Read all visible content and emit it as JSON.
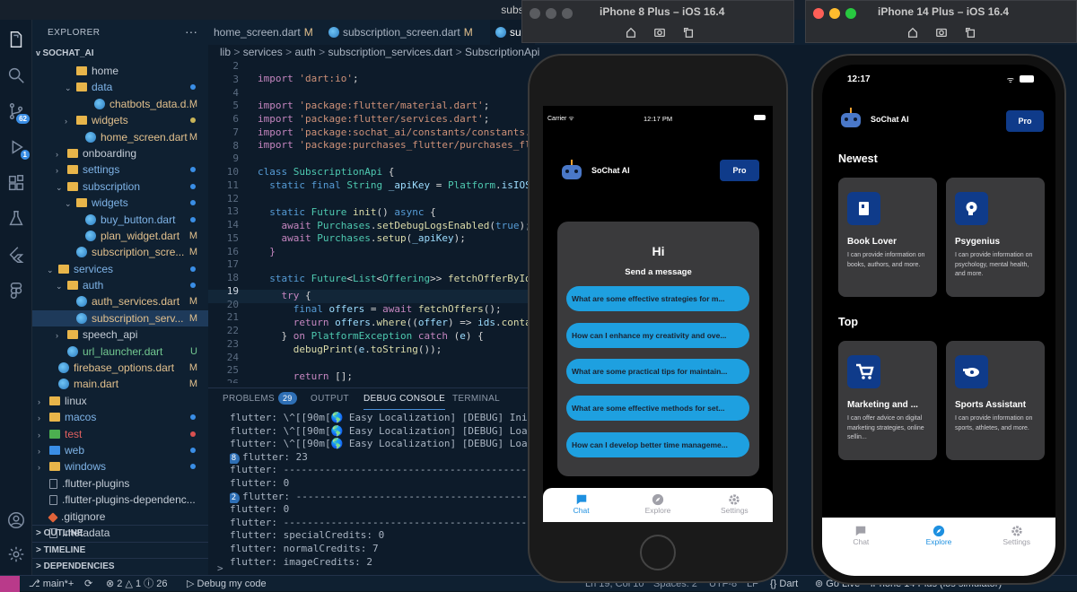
{
  "vscode": {
    "window_title": "subscription_se",
    "explorer_title": "EXPLORER",
    "explorer_more": "···",
    "root": "SOCHAT_AI",
    "scm_badge": "62",
    "debug_badge": "1",
    "tree": [
      {
        "label": "home",
        "type": "folder",
        "depth": 3,
        "chev": "",
        "status": ""
      },
      {
        "label": "data",
        "type": "folder",
        "depth": 3,
        "chev": "v",
        "status": "dot",
        "status_color": "#3a8ee6"
      },
      {
        "label": "chatbots_data.d...",
        "type": "dart",
        "depth": 5,
        "chev": "",
        "status": "M"
      },
      {
        "label": "widgets",
        "type": "folder",
        "depth": 3,
        "chev": ">",
        "status": "dot",
        "status_color": "#c9b458",
        "color": "#e2c08d"
      },
      {
        "label": "home_screen.dart",
        "type": "dart",
        "depth": 4,
        "chev": "",
        "status": "M"
      },
      {
        "label": "onboarding",
        "type": "folder",
        "depth": 2,
        "chev": ">",
        "status": ""
      },
      {
        "label": "settings",
        "type": "folder",
        "depth": 2,
        "chev": ">",
        "status": "dot",
        "status_color": "#3a8ee6"
      },
      {
        "label": "subscription",
        "type": "folder",
        "depth": 2,
        "chev": "v",
        "status": "dot",
        "status_color": "#3a8ee6"
      },
      {
        "label": "widgets",
        "type": "folder",
        "depth": 3,
        "chev": "v",
        "status": "dot",
        "status_color": "#3a8ee6"
      },
      {
        "label": "buy_button.dart",
        "type": "dart",
        "depth": 4,
        "chev": "",
        "status": "dot",
        "status_color": "#3a8ee6"
      },
      {
        "label": "plan_widget.dart",
        "type": "dart",
        "depth": 4,
        "chev": "",
        "status": "M"
      },
      {
        "label": "subscription_scre...",
        "type": "dart",
        "depth": 3,
        "chev": "",
        "status": "M"
      },
      {
        "label": "services",
        "type": "folder",
        "depth": 1,
        "chev": "v",
        "status": "dot",
        "status_color": "#3a8ee6"
      },
      {
        "label": "auth",
        "type": "folder",
        "depth": 2,
        "chev": "v",
        "status": "dot",
        "status_color": "#3a8ee6"
      },
      {
        "label": "auth_services.dart",
        "type": "dart",
        "depth": 3,
        "chev": "",
        "status": "M"
      },
      {
        "label": "subscription_serv...",
        "type": "dart",
        "depth": 3,
        "chev": "",
        "status": "M",
        "selected": true
      },
      {
        "label": "speech_api",
        "type": "folder",
        "depth": 2,
        "chev": ">",
        "status": ""
      },
      {
        "label": "url_launcher.dart",
        "type": "dart",
        "depth": 2,
        "chev": "",
        "status": "U"
      },
      {
        "label": "firebase_options.dart",
        "type": "dart",
        "depth": 1,
        "chev": "",
        "status": "M"
      },
      {
        "label": "main.dart",
        "type": "dart",
        "depth": 1,
        "chev": "",
        "status": "M"
      },
      {
        "label": "linux",
        "type": "folder",
        "depth": 0,
        "chev": ">",
        "status": ""
      },
      {
        "label": "macos",
        "type": "folder",
        "depth": 0,
        "chev": ">",
        "status": "dot",
        "status_color": "#3a8ee6"
      },
      {
        "label": "test",
        "type": "folder",
        "depth": 0,
        "chev": ">",
        "status": "dot",
        "status_color": "#d85050",
        "color": "#e06060",
        "icon_color": "#4caf50"
      },
      {
        "label": "web",
        "type": "folder",
        "depth": 0,
        "chev": ">",
        "status": "dot",
        "status_color": "#3a8ee6",
        "icon_color": "#3a8ee6"
      },
      {
        "label": "windows",
        "type": "folder",
        "depth": 0,
        "chev": ">",
        "status": "dot",
        "status_color": "#3a8ee6"
      },
      {
        "label": ".flutter-plugins",
        "type": "file",
        "depth": 0,
        "chev": "",
        "status": ""
      },
      {
        "label": ".flutter-plugins-dependenc...",
        "type": "file",
        "depth": 0,
        "chev": "",
        "status": ""
      },
      {
        "label": ".gitignore",
        "type": "git",
        "depth": 0,
        "chev": "",
        "status": ""
      },
      {
        "label": ".metadata",
        "type": "file",
        "depth": 0,
        "chev": "",
        "status": ""
      }
    ],
    "sections": [
      "OUTLINE",
      "TIMELINE",
      "DEPENDENCIES"
    ],
    "tabs": [
      {
        "label": "home_screen.dart",
        "mod": "M"
      },
      {
        "label": "subscription_screen.dart",
        "mod": "M"
      },
      {
        "label": "su",
        "mod": ""
      }
    ],
    "breadcrumb": [
      "lib",
      ">",
      "services",
      ">",
      "auth",
      ">",
      "subscription_services.dart",
      ">",
      "SubscriptionApi",
      ">",
      "fetchOffersByI"
    ],
    "line_numbers": [
      "2",
      "3",
      "4",
      "5",
      "6",
      "7",
      "8",
      "9",
      "10",
      "11",
      "12",
      "13",
      "14",
      "15",
      "16",
      "17",
      "18",
      "19",
      "20",
      "21",
      "22",
      "23",
      "24",
      "25",
      "26"
    ],
    "panel_tabs": [
      "PROBLEMS",
      "OUTPUT",
      "DEBUG CONSOLE",
      "TERMINAL"
    ],
    "problems_count": "29",
    "console": [
      {
        "count": "",
        "text": "flutter: \\^[[90m[🌎 Easy Localization] [DEBUG] Init prov"
      },
      {
        "count": "",
        "text": "flutter: \\^[[90m[🌎 Easy Localization] [DEBUG] Load Loca"
      },
      {
        "count": "",
        "text": "flutter: \\^[[90m[🌎 Easy Localization] [DEBUG] Load asse"
      },
      {
        "count": "8",
        "text": "flutter: 23"
      },
      {
        "count": "",
        "text": "flutter: ---------------------------------------------"
      },
      {
        "count": "",
        "text": "flutter: 0"
      },
      {
        "count": "2",
        "text": "flutter: --------------------------------------------"
      },
      {
        "count": "",
        "text": "flutter: 0"
      },
      {
        "count": "",
        "text": "flutter: ---------------------------------------------"
      },
      {
        "count": "",
        "text": "flutter: specialCredits: 0"
      },
      {
        "count": "",
        "text": "flutter: normalCredits: 7"
      },
      {
        "count": "",
        "text": "flutter: imageCredits: 2"
      }
    ],
    "prompt": ">",
    "status": {
      "branch": "main*+",
      "errors": "2",
      "warnings": "1",
      "infos": "26",
      "debug": "Debug my code",
      "position": "Ln 19, Col 10",
      "spaces": "Spaces: 2",
      "encoding": "UTF-8",
      "eol": "LF",
      "lang": "Dart",
      "golive": "Go Live",
      "device": "iPhone 14 Plus (ios simulator)"
    }
  },
  "sim1": {
    "title": "iPhone 8 Plus – iOS 16.4",
    "carrier": "Carrier",
    "time": "12:17 PM",
    "app_name": "SoChat AI",
    "pro": "Pro",
    "hi": "Hi",
    "send_message": "Send a message",
    "suggestions": [
      "What are some effective strategies for m...",
      "How can I enhance my creativity and ove...",
      "What are some practical tips for maintain...",
      "What are some effective methods for set...",
      "How can I develop better time manageme..."
    ],
    "tabs": [
      "Chat",
      "Explore",
      "Settings"
    ],
    "active_tab": 0
  },
  "sim2": {
    "title": "iPhone 14 Plus – iOS 16.4",
    "time": "12:17",
    "app_name": "SoChat AI",
    "pro": "Pro",
    "newest": "Newest",
    "top": "Top",
    "cards": [
      {
        "name": "Book Lover",
        "desc": "I can provide information on books, authors, and more.",
        "icon": "book-icon"
      },
      {
        "name": "Psygenius",
        "desc": "I can provide information on psychology, mental health, and more.",
        "icon": "brain-icon"
      },
      {
        "name": "Marketing and ...",
        "desc": "I can offer advice on digital marketing strategies, online sellin...",
        "icon": "cart-icon"
      },
      {
        "name": "Sports Assistant",
        "desc": "I can provide information on sports, athletes, and more.",
        "icon": "whistle-icon"
      }
    ],
    "tabs": [
      "Chat",
      "Explore",
      "Settings"
    ],
    "active_tab": 1
  },
  "colors": {
    "accent": "#1ea0e0",
    "pro": "#0f3b8a",
    "card": "#3a3a3c",
    "vscode_bg": "#0d1b2a"
  }
}
